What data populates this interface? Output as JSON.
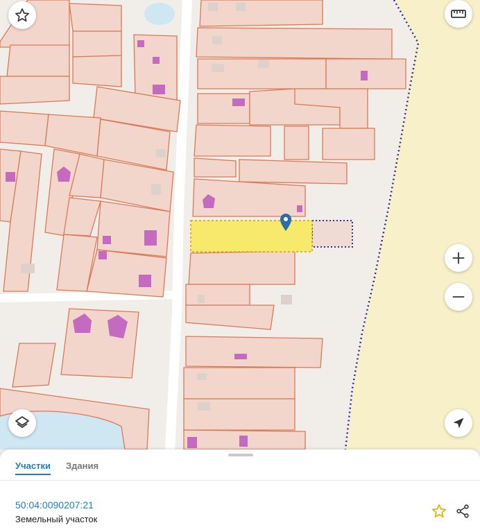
{
  "map": {
    "selected_parcel_color": "#f7e96b",
    "parcel_fill": "#f3d6cb",
    "parcel_border": "#d97856",
    "building_color": "#c46ac0",
    "forest_color": "#f7f0c8",
    "water_color": "#cfe6f3",
    "boundary_color": "#2b2e8f"
  },
  "controls": {
    "favorite_icon": "star-outline-icon",
    "ruler_icon": "ruler-icon",
    "zoom_in_icon": "plus-icon",
    "zoom_out_icon": "minus-icon",
    "layers_icon": "layers-icon",
    "locate_icon": "navigation-arrow-icon"
  },
  "sheet": {
    "tabs": [
      {
        "label": "Участки",
        "active": true
      },
      {
        "label": "Здания",
        "active": false
      }
    ],
    "cadastral_number": "50:04:0090207:21",
    "object_type": "Земельный участок"
  }
}
